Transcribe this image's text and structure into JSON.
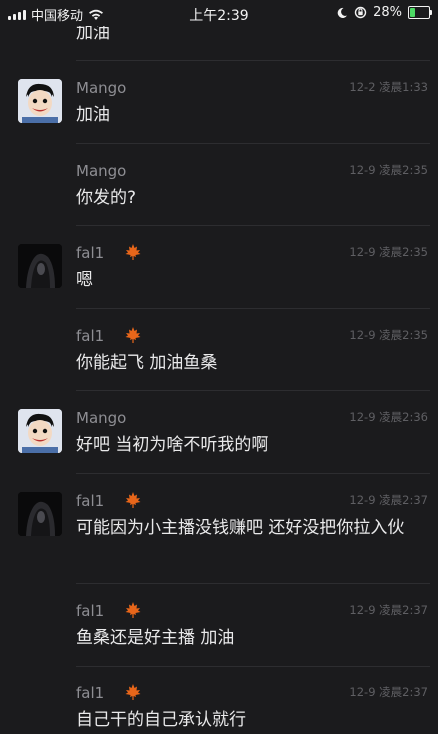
{
  "status_bar": {
    "carrier": "中国移动",
    "time": "上午2:39",
    "battery": "28%",
    "battery_level": 0.28,
    "icons": [
      "signal-icon",
      "wifi-icon",
      "moon-icon",
      "orientation-lock-icon",
      "battery-charging-icon"
    ]
  },
  "messages": [
    {
      "author": "",
      "avatar": "none",
      "badge": false,
      "time": "",
      "text": "加油"
    },
    {
      "author": "Mango",
      "avatar": "mango",
      "badge": false,
      "time": "12-2 凌晨1:33",
      "text": "加油"
    },
    {
      "author": "Mango",
      "avatar": "none",
      "badge": false,
      "time": "12-9 凌晨2:35",
      "text": "你发的?"
    },
    {
      "author": "fal1",
      "avatar": "fal1",
      "badge": true,
      "time": "12-9 凌晨2:35",
      "text": "嗯"
    },
    {
      "author": "fal1",
      "avatar": "none",
      "badge": true,
      "time": "12-9 凌晨2:35",
      "text": "你能起飞 加油鱼桑"
    },
    {
      "author": "Mango",
      "avatar": "mango",
      "badge": false,
      "time": "12-9 凌晨2:36",
      "text": "好吧 当初为啥不听我的啊"
    },
    {
      "author": "fal1",
      "avatar": "fal1",
      "badge": true,
      "time": "12-9 凌晨2:37",
      "text": "可能因为小主播没钱赚吧 还好没把你拉入伙"
    },
    {
      "author": "fal1",
      "avatar": "none",
      "badge": true,
      "time": "12-9 凌晨2:37",
      "text": "鱼桑还是好主播 加油"
    },
    {
      "author": "fal1",
      "avatar": "none",
      "badge": true,
      "time": "12-9 凌晨2:37",
      "text": "自己干的自己承认就行"
    }
  ],
  "colors": {
    "background": "#1b1b1d",
    "text": "#e9e9ea",
    "author": "#8e8e93",
    "timestamp": "#5f5f63",
    "badge": "#e8661a"
  }
}
